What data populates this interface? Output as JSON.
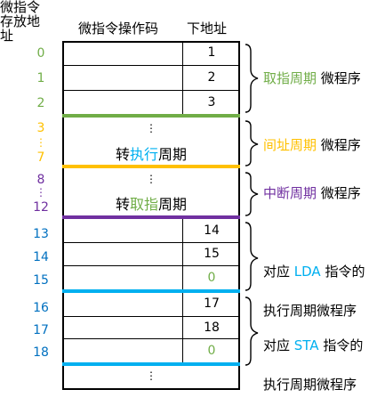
{
  "colors": {
    "green": "#70ad47",
    "orange": "#ffc000",
    "purple": "#7030a0",
    "blue": "#00b0f0",
    "black": "#000000"
  },
  "header": {
    "left_label": "微指令\n存放地\n址",
    "opcode_label": "微指令操作码",
    "next_addr_label": "下地址"
  },
  "addresses": {
    "a0": "0",
    "a1": "1",
    "a2": "2",
    "a3": "3",
    "a3_dots": "⋮",
    "a7": "7",
    "a8": "8",
    "a8_dots": "⋮",
    "a12": "12",
    "a13": "13",
    "a14": "14",
    "a15": "15",
    "a16": "16",
    "a17": "17",
    "a18": "18"
  },
  "cells": {
    "next0": "1",
    "next1": "2",
    "next2": "3",
    "dots_indirect": "⋮",
    "to_execute_prefix": "转",
    "to_execute_color": "执行",
    "to_execute_suffix": "周期",
    "dots_interrupt": "⋮",
    "to_fetch_prefix": "转",
    "to_fetch_color": "取指",
    "to_fetch_suffix": "周期",
    "next13": "14",
    "next14": "15",
    "next15": "0",
    "next16": "17",
    "next17": "18",
    "next18": "0",
    "dots_bottom": "⋮"
  },
  "annotations": {
    "fetch_colored": "取指周期",
    "fetch_rest": " 微程序",
    "indirect_colored": "间址周期",
    "indirect_rest": " 微程序",
    "interrupt_colored": "中断周期",
    "interrupt_rest": " 微程序",
    "lda_prefix": "对应 ",
    "lda_colored": "LDA",
    "lda_suffix": " 指令的",
    "lda_line2": "执行周期微程序",
    "sta_prefix": "对应 ",
    "sta_colored": "STA",
    "sta_suffix": " 指令的",
    "sta_line2": "执行周期微程序"
  }
}
